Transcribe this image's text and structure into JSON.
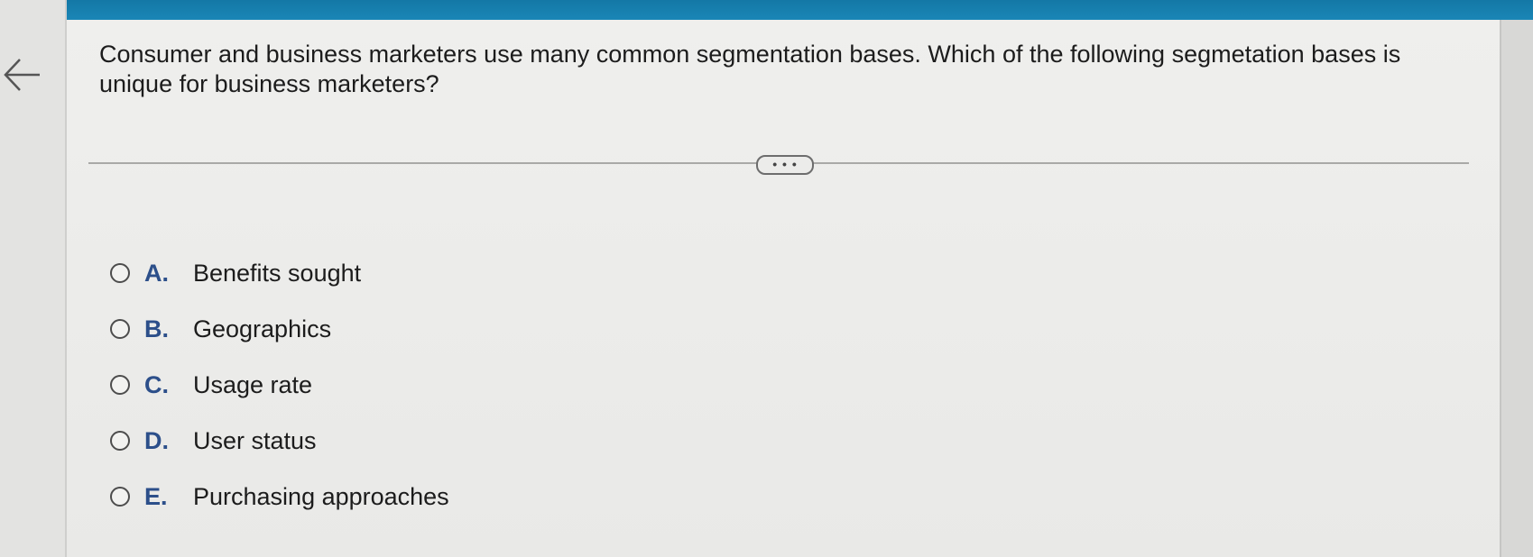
{
  "question": {
    "text": "Consumer and business marketers use many common segmentation bases. Which of the following segmetation bases is unique for business marketers?"
  },
  "navigation": {
    "back_icon": "arrow-left-icon"
  },
  "more_button": {
    "label": "• • •"
  },
  "options": [
    {
      "letter": "A.",
      "text": "Benefits sought"
    },
    {
      "letter": "B.",
      "text": "Geographics"
    },
    {
      "letter": "C.",
      "text": "Usage rate"
    },
    {
      "letter": "D.",
      "text": "User status"
    },
    {
      "letter": "E.",
      "text": "Purchasing approaches"
    }
  ],
  "colors": {
    "top_bar": "#1478a6",
    "option_letter": "#2c4f8a",
    "text": "#1c1c1c"
  }
}
